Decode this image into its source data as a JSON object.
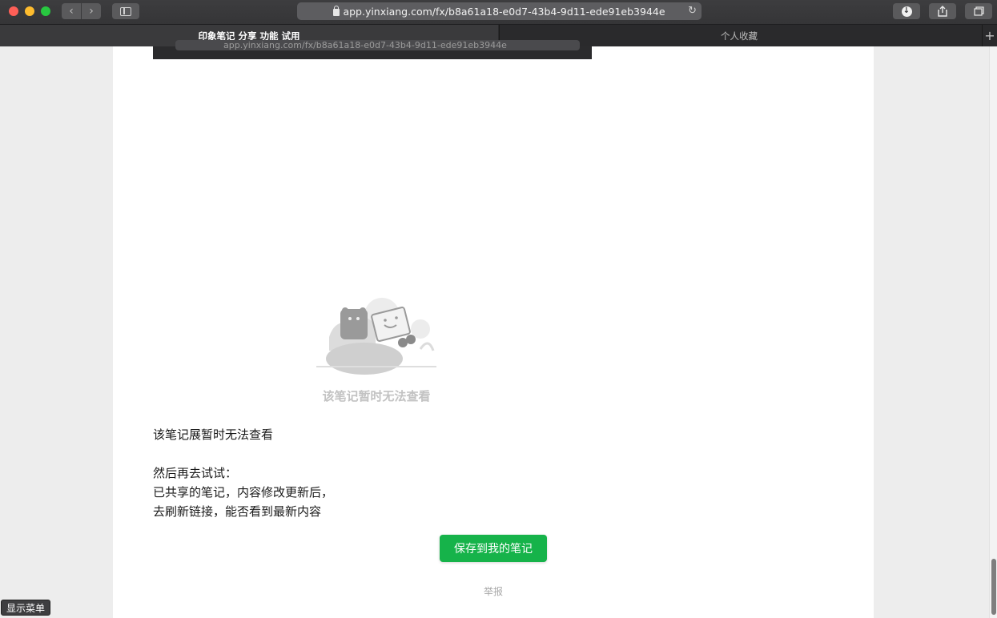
{
  "browser": {
    "url": "app.yinxiang.com/fx/b8a61a18-e0d7-43b4-9d11-ede91eb3944e",
    "tabs": [
      {
        "label": "印象笔记 分享 功能 试用",
        "active": true
      },
      {
        "label": "个人收藏",
        "active": false
      }
    ]
  },
  "note": {
    "embedded_url_fragment": "app.yinxiang.com/fx/b8a61a18-e0d7-43b4-9d11-ede91eb3944e",
    "illustration_caption": "该笔记暂时无法查看",
    "lines": [
      "该笔记展暂时无法查看",
      "然后再去试试：",
      "已共享的笔记，内容修改更新后，",
      "去刷新链接，能否看到最新内容"
    ],
    "save_button": "保存到我的笔记",
    "report_link": "举报"
  },
  "overlay": {
    "menu_badge": "显示菜单"
  },
  "colors": {
    "accent_green": "#16b34a"
  }
}
